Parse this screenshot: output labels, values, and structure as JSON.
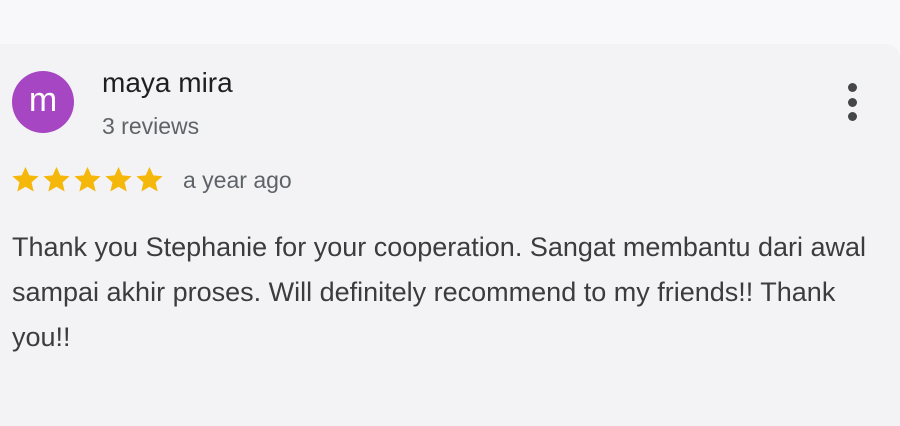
{
  "review": {
    "avatar_letter": "m",
    "author_name": "maya mira",
    "review_count": "3 reviews",
    "rating": 5,
    "rating_max": 5,
    "time_ago": "a year ago",
    "text": "Thank you Stephanie for your cooperation. Sangat membantu dari awal sampai akhir proses. Will definitely recommend to my friends!! Thank you!!"
  },
  "icons": {
    "more": "more-vert-icon",
    "star": "star-icon"
  },
  "colors": {
    "avatar_bg": "#a746c2",
    "star": "#f5b80a",
    "text": "#3c3c3c",
    "secondary_text": "#5f6368",
    "card_bg": "#f3f3f6"
  }
}
